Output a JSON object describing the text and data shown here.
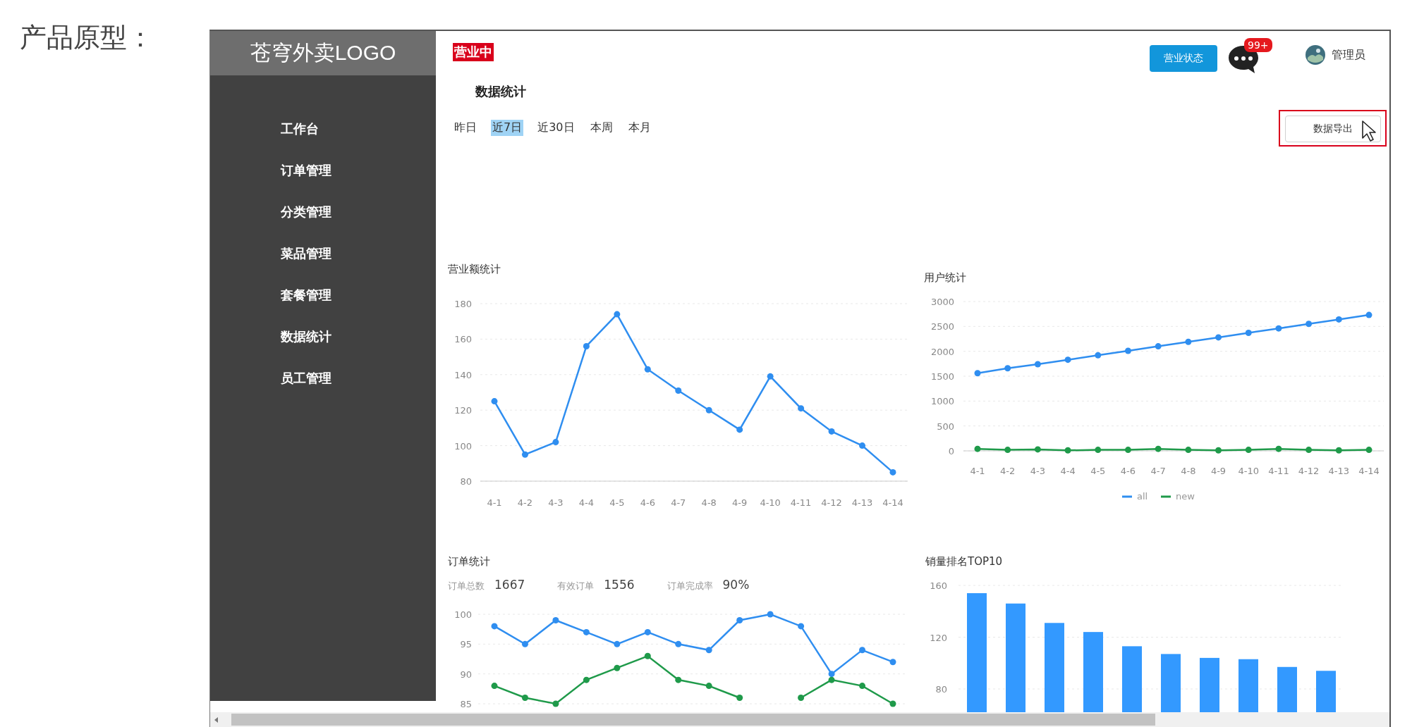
{
  "page_heading": "产品原型：",
  "sidebar": {
    "logo": "苍穹外卖LOGO",
    "items": [
      {
        "label": "工作台"
      },
      {
        "label": "订单管理"
      },
      {
        "label": "分类管理"
      },
      {
        "label": "菜品管理"
      },
      {
        "label": "套餐管理"
      },
      {
        "label": "数据统计"
      },
      {
        "label": "员工管理"
      }
    ]
  },
  "header": {
    "status_badge": "营业中",
    "status_button": "营业状态",
    "notification_badge": "99+",
    "user": "管理员"
  },
  "page_title": "数据统计",
  "range_tabs": [
    {
      "label": "昨日",
      "selected": false
    },
    {
      "label": "近7日",
      "selected": true
    },
    {
      "label": "近30日",
      "selected": false
    },
    {
      "label": "本周",
      "selected": false
    },
    {
      "label": "本月",
      "selected": false
    }
  ],
  "export_button": "数据导出",
  "revenue": {
    "title": "营业额统计",
    "chart_data": {
      "type": "line",
      "grid": true,
      "categories": [
        "4-1",
        "4-2",
        "4-3",
        "4-4",
        "4-5",
        "4-6",
        "4-7",
        "4-8",
        "4-9",
        "4-10",
        "4-11",
        "4-12",
        "4-13",
        "4-14"
      ],
      "ylim": [
        80,
        180
      ],
      "yticks": [
        80,
        100,
        120,
        140,
        160,
        180
      ],
      "series": [
        {
          "color": "#2f8ef0",
          "marker": true,
          "values": [
            125,
            95,
            102,
            156,
            174,
            143,
            131,
            120,
            109,
            139,
            121,
            108,
            100,
            85
          ]
        }
      ]
    }
  },
  "users": {
    "title": "用户统计",
    "chart_data": {
      "type": "line",
      "grid": true,
      "legend": "bottom",
      "categories": [
        "4-1",
        "4-2",
        "4-3",
        "4-4",
        "4-5",
        "4-6",
        "4-7",
        "4-8",
        "4-9",
        "4-10",
        "4-11",
        "4-12",
        "4-13",
        "4-14"
      ],
      "ylim": [
        0,
        3000
      ],
      "yticks": [
        0,
        500,
        1000,
        1500,
        2000,
        2500,
        3000
      ],
      "series": [
        {
          "name": "all",
          "color": "#2f8ef0",
          "marker": true,
          "values": [
            1560,
            1660,
            1740,
            1830,
            1920,
            2010,
            2100,
            2190,
            2280,
            2370,
            2460,
            2550,
            2640,
            2730
          ]
        },
        {
          "name": "new",
          "color": "#1f9a4a",
          "marker": true,
          "values": [
            40,
            20,
            30,
            10,
            20,
            20,
            40,
            20,
            10,
            20,
            40,
            20,
            10,
            20
          ]
        }
      ]
    }
  },
  "orders": {
    "title": "订单统计",
    "stats": [
      {
        "label": "订单总数",
        "value": "1667"
      },
      {
        "label": "有效订单",
        "value": "1556"
      },
      {
        "label": "订单完成率",
        "value": "90%"
      }
    ],
    "chart_data": {
      "type": "line",
      "grid": true,
      "ylim": [
        85,
        100
      ],
      "yticks": [
        85,
        90,
        95,
        100
      ],
      "series": [
        {
          "color": "#2f8ef0",
          "marker": true,
          "values": [
            98,
            95,
            99,
            97,
            95,
            97,
            95,
            94,
            99,
            100,
            98,
            90,
            94,
            92
          ]
        },
        {
          "color": "#1f9a4a",
          "marker": true,
          "values": [
            88,
            86,
            85,
            89,
            91,
            93,
            89,
            88,
            86,
            null,
            86,
            89,
            88,
            85
          ]
        }
      ]
    }
  },
  "top10": {
    "title": "销量排名TOP10",
    "chart_data": {
      "type": "bar",
      "grid": true,
      "ylim": [
        60,
        160
      ],
      "yticks": [
        80,
        120,
        160
      ],
      "series": [
        {
          "color": "#3399ff",
          "values": [
            154,
            146,
            131,
            124,
            113,
            107,
            104,
            103,
            97,
            94
          ]
        }
      ]
    }
  }
}
